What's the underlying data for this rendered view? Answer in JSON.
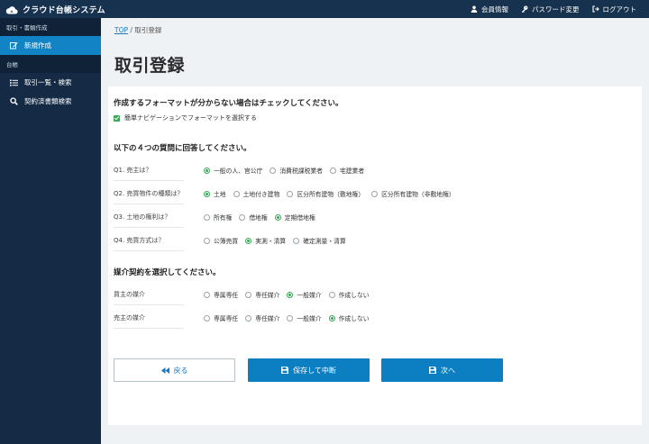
{
  "app": {
    "title": "クラウド台帳システム"
  },
  "topnav": {
    "member": "会員情報",
    "password": "パスワード変更",
    "logout": "ログアウト"
  },
  "sidebar": {
    "section1": "取引・書類作成",
    "new": "新規作成",
    "section2": "台帳",
    "list": "取引一覧・検索",
    "contract_search": "契約済書類検索"
  },
  "breadcrumb": {
    "top": "TOP",
    "sep": "/",
    "current": "取引登録"
  },
  "page": {
    "title": "取引登録"
  },
  "format": {
    "title": "作成するフォーマットが分からない場合はチェックしてください。",
    "checkbox_label": "簡単ナビゲーションでフォーマットを選択する",
    "checked": true
  },
  "questions": {
    "title": "以下の４つの質問に回答してください。",
    "items": [
      {
        "label": "Q1. 売主は？",
        "options": [
          "一般の人、官公庁",
          "消費税課税業者",
          "宅建業者"
        ],
        "selected": 0
      },
      {
        "label": "Q2. 売買物件の種類は？",
        "options": [
          "土地",
          "土地付き建物",
          "区分所有建物（敷地権）",
          "区分所有建物（非敷地権）"
        ],
        "selected": 0
      },
      {
        "label": "Q3. 土地の権利は？",
        "options": [
          "所有権",
          "借地権",
          "定期借地権"
        ],
        "selected": 2
      },
      {
        "label": "Q4. 売買方式は？",
        "options": [
          "公簿売買",
          "実測・清算",
          "確定測量・清算"
        ],
        "selected": 1
      }
    ]
  },
  "mediation": {
    "title": "媒介契約を選択してください。",
    "items": [
      {
        "label": "買主の媒介",
        "options": [
          "専属専任",
          "専任媒介",
          "一般媒介",
          "作成しない"
        ],
        "selected": 2
      },
      {
        "label": "売主の媒介",
        "options": [
          "専属専任",
          "専任媒介",
          "一般媒介",
          "作成しない"
        ],
        "selected": 3
      }
    ]
  },
  "buttons": {
    "back": "戻る",
    "save": "保存して中断",
    "next": "次へ"
  },
  "colors": {
    "topbar": "#17324f",
    "sidebar": "#152a44",
    "accent": "#1283c4",
    "radio_selected": "#3aa757"
  },
  "icons": [
    "cloud-icon",
    "user-icon",
    "key-icon",
    "logout-icon",
    "edit-icon",
    "list-icon",
    "search-icon",
    "rewind-icon",
    "save-icon"
  ]
}
